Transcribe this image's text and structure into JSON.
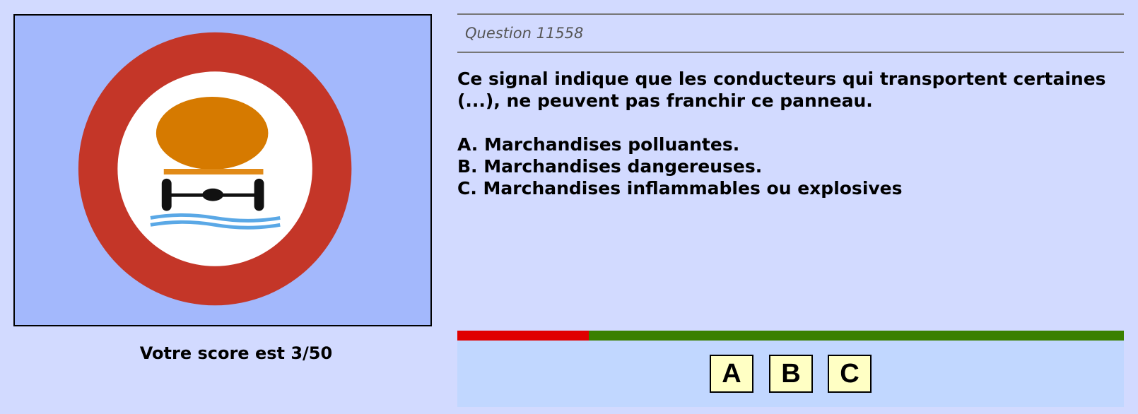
{
  "question": {
    "number_label": "Question 11558",
    "text": "Ce signal indique que les conducteurs qui transportent certaines (...), ne peuvent pas franchir ce panneau.",
    "answers": [
      "A. Marchandises polluantes.",
      "B. Marchandises dangereuses.",
      "C. Marchandises inflammables ou explosives"
    ]
  },
  "score": {
    "text": "Votre score est 3/50"
  },
  "progress": {
    "fraction_red": 0.197
  },
  "buttons": [
    {
      "label": "A"
    },
    {
      "label": "B"
    },
    {
      "label": "C"
    }
  ],
  "sign": {
    "icon": "no-water-polluting-goods-sign",
    "colors": {
      "background": "#a3b8fc",
      "ring": "#c43628",
      "tank": "#d67a00",
      "water": "#5aa8e6"
    }
  },
  "colors": {
    "page_background": "#d2daff",
    "progress_red": "#e00000",
    "progress_green": "#3a8000",
    "button_area": "#c1d7ff",
    "button_fill": "#ffffc4"
  }
}
